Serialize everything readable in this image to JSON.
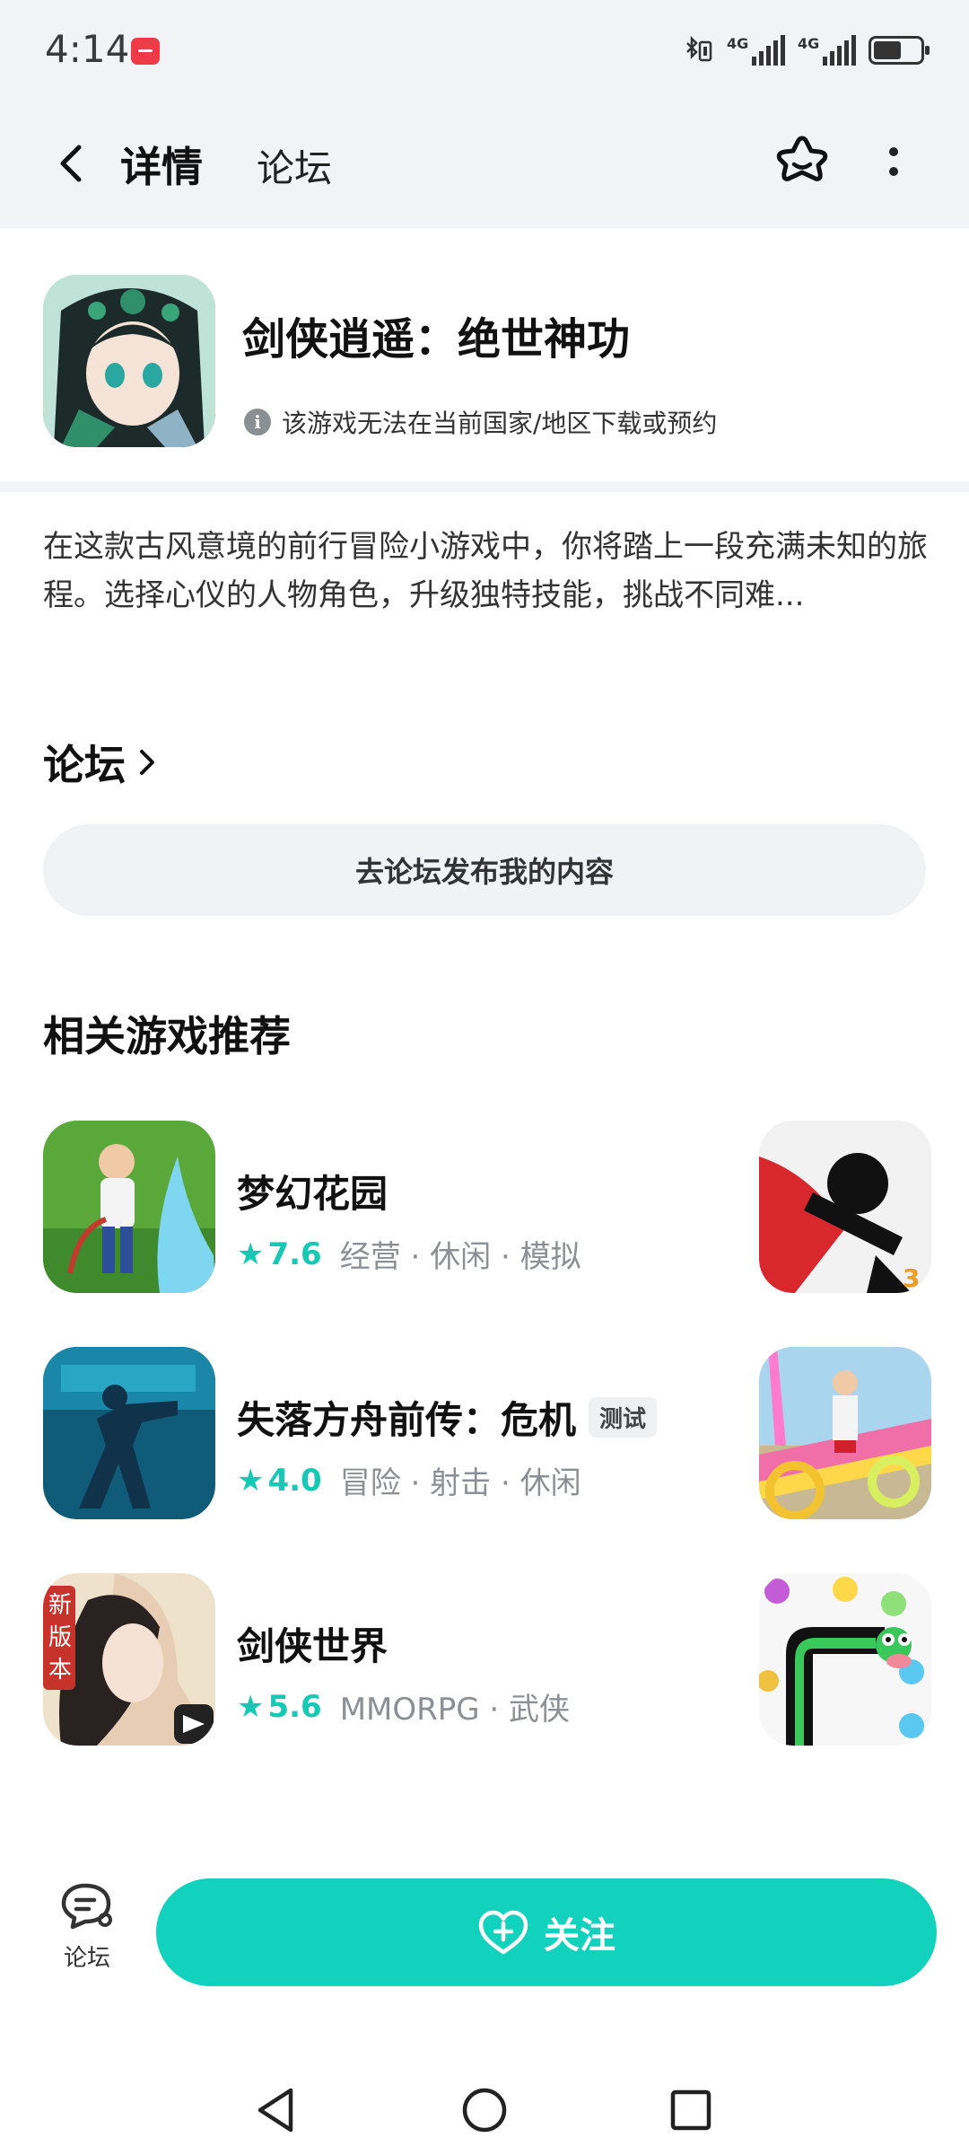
{
  "status_bar": {
    "time": "4:14",
    "net1": "4G",
    "net2": "4G"
  },
  "header": {
    "tab_detail": "详情",
    "tab_forum": "论坛"
  },
  "app": {
    "title": "剑侠逍遥：绝世神功",
    "notice": "该游戏无法在当前国家/地区下载或预约",
    "description": "在这款古风意境的前行冒险小游戏中，你将踏上一段充满未知的旅程。选择心仪的人物角色，升级独特技能，挑战不同难..."
  },
  "forum": {
    "title": "论坛",
    "post_button": "去论坛发布我的内容"
  },
  "recommend": {
    "title": "相关游戏推荐",
    "items": [
      {
        "name": "梦幻花园",
        "rating": "7.6",
        "tags": "经营 · 休闲 · 模拟"
      },
      {
        "name": "失落方舟前传：危机",
        "badge": "测试",
        "rating": "4.0",
        "tags": "冒险 · 射击 · 休闲"
      },
      {
        "name": "剑侠世界",
        "rating": "5.6",
        "tags": "MMORPG · 武侠"
      }
    ]
  },
  "bottom": {
    "forum_label": "论坛",
    "follow_label": "关注"
  },
  "colors": {
    "accent": "#12d1bd",
    "rating": "#16c9b5"
  }
}
